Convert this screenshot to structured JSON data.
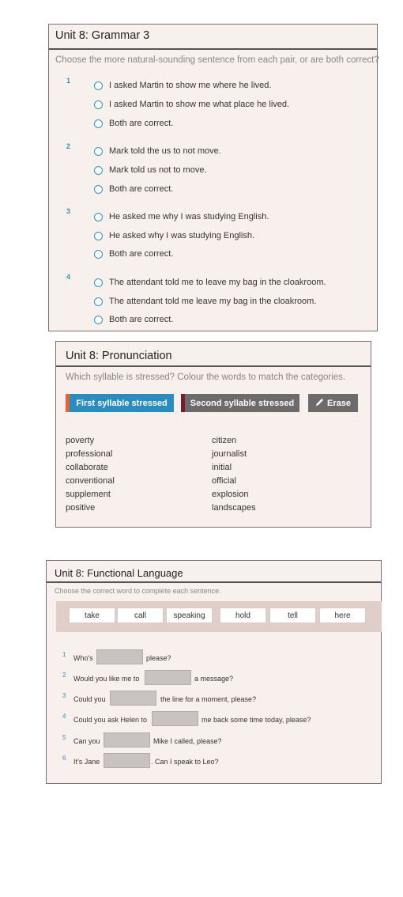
{
  "grammar": {
    "title": "Unit 8: Grammar 3",
    "instruction": "Choose the more natural-sounding sentence from each pair, or are both correct?",
    "questions": [
      {
        "num": "1",
        "options": [
          "I asked Martin to show me where he lived.",
          "I asked Martin to show me what place he lived.",
          "Both are correct."
        ]
      },
      {
        "num": "2",
        "options": [
          "Mark told the us to not move.",
          "Mark told us not to move.",
          "Both are correct."
        ]
      },
      {
        "num": "3",
        "options": [
          "He asked me why I was studying English.",
          "He asked why I was studying English.",
          "Both are correct."
        ]
      },
      {
        "num": "4",
        "options": [
          "The attendant told me to leave my bag in the cloakroom.",
          "The attendant told me leave my bag in the cloakroom.",
          "Both are correct."
        ]
      }
    ]
  },
  "pronunciation": {
    "title": "Unit 8: Pronunciation",
    "instruction": "Which syllable is stressed? Colour the words to match the categories.",
    "buttons": {
      "first": "First syllable stressed",
      "second": "Second syllable stressed",
      "erase": "Erase",
      "erase_icon": "pencil-icon"
    },
    "col1": [
      "poverty",
      "professional",
      "collaborate",
      "conventional",
      "supplement",
      "positive"
    ],
    "col2": [
      "citizen",
      "journalist",
      "initial",
      "official",
      "explosion",
      "landscapes"
    ],
    "colors": {
      "first": "#2b8cbf",
      "first_accent": "#e0663a",
      "second": "#6c6a6a",
      "second_accent": "#7a1d2b",
      "erase": "#6c6a6a"
    }
  },
  "functional": {
    "title": "Unit 8: Functional Language",
    "instruction": "Choose the correct word to complete each sentence.",
    "words": [
      "take",
      "call",
      "speaking",
      "hold",
      "tell",
      "here"
    ],
    "sentences": [
      {
        "num": "1",
        "before": "Who's",
        "after": "please?"
      },
      {
        "num": "2",
        "before": "Would you like me to",
        "after": "a message?"
      },
      {
        "num": "3",
        "before": "Could you",
        "after": "the line for a moment, please?"
      },
      {
        "num": "4",
        "before": "Could you ask Helen to",
        "after": "me back some time today, please?"
      },
      {
        "num": "5",
        "before": "Can you",
        "after": "Mike I called, please?"
      },
      {
        "num": "6",
        "before": "It's Jane",
        "after": ". Can I speak to Leo?"
      }
    ]
  }
}
